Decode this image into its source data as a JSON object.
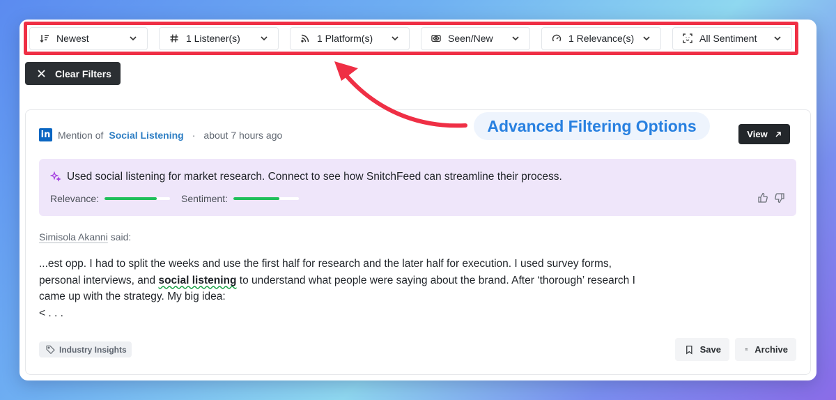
{
  "filters": [
    {
      "label": "Newest",
      "icon": "sort-icon"
    },
    {
      "label": "1 Listener(s)",
      "icon": "hash-icon"
    },
    {
      "label": "1 Platform(s)",
      "icon": "rss-icon"
    },
    {
      "label": "Seen/New",
      "icon": "eye-icon"
    },
    {
      "label": "1 Relevance(s)",
      "icon": "gauge-icon"
    },
    {
      "label": "All Sentiment",
      "icon": "face-scan-icon"
    }
  ],
  "clear_filters_label": "Clear Filters",
  "annotation": {
    "text": "Advanced Filtering Options",
    "color": "#2880e0",
    "arrow_color": "#ef2f45"
  },
  "mention": {
    "platform_icon": "linkedin-icon",
    "platform_icon_text": "in",
    "prefix": "Mention of",
    "listener": "Social Listening",
    "separator": "·",
    "time": "about 7 hours ago",
    "view_label": "View",
    "insight": "Used social listening for market research. Connect to see how SnitchFeed can streamline their process.",
    "relevance_label": "Relevance:",
    "relevance_value": 0.8,
    "sentiment_label": "Sentiment:",
    "sentiment_value": 0.7,
    "author": "Simisola Akanni",
    "author_suffix": " said:",
    "body_before": "...est opp. I had to split the weeks and use the first half for research and the later half for execution. I used survey forms, personal interviews, and ",
    "body_keyword": "social listening",
    "body_after": " to understand what people were saying about the brand. After ‘thorough’ research I came up with the strategy. My big idea:",
    "body_last": "< . . .",
    "tag": "Industry Insights",
    "save_label": "Save",
    "archive_label": "Archive"
  },
  "colors": {
    "accent_red": "#ef2f45",
    "meter_green": "#1fbf5a",
    "insight_bg": "#efe6fa",
    "link_blue": "#2f7fc4"
  }
}
